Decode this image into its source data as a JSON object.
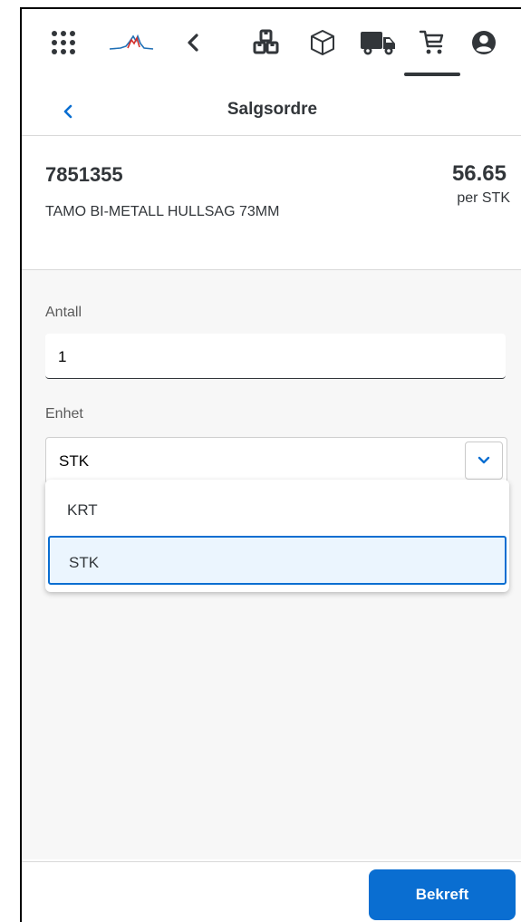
{
  "toolbar": {
    "icons": [
      "apps-grid-icon",
      "company-logo",
      "chevron-left-icon",
      "boxes-icon",
      "package-icon",
      "truck-icon",
      "cart-icon",
      "user-icon"
    ],
    "active": "cart-icon"
  },
  "header": {
    "title": "Salgsordre"
  },
  "item": {
    "number": "7851355",
    "description": "TAMO BI-METALL HULLSAG 73MM",
    "price": "56.65",
    "unit_label": "per STK"
  },
  "form": {
    "quantity_label": "Antall",
    "quantity_value": "1",
    "unit_label": "Enhet",
    "unit_value": "STK",
    "unit_options": [
      "KRT",
      "STK"
    ],
    "selected_option": "STK"
  },
  "footer": {
    "confirm_label": "Bekreft"
  },
  "colors": {
    "accent": "#0a6ed1",
    "text": "#32363a",
    "selected_bg": "#ebf5fe",
    "logo_red": "#d6302b",
    "logo_blue": "#1f6fb5"
  }
}
